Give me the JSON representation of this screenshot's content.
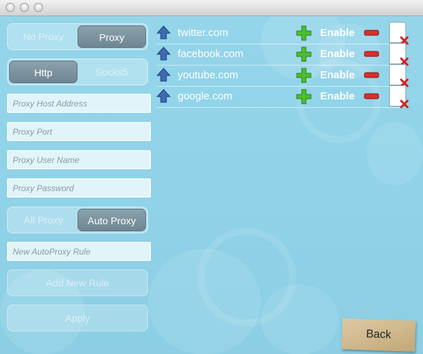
{
  "proxy_mode": {
    "options": [
      "No Proxy",
      "Proxy"
    ],
    "selected": "Proxy"
  },
  "protocol": {
    "options": [
      "Http",
      "Socks5"
    ],
    "selected": "Http"
  },
  "fields": {
    "host_placeholder": "Proxy Host Address",
    "port_placeholder": "Proxy Port",
    "user_placeholder": "Proxy User Name",
    "password_placeholder": "Proxy Password",
    "autoproxy_rule_placeholder": "New AutoProxy Rule"
  },
  "scope": {
    "options": [
      "All Proxy",
      "Auto Proxy"
    ],
    "selected": "Auto Proxy"
  },
  "buttons": {
    "add_rule": "Add New Rule",
    "apply": "Apply",
    "back": "Back"
  },
  "rules": [
    {
      "domain": "twitter.com",
      "enable_label": "Enable"
    },
    {
      "domain": "facebook.com",
      "enable_label": "Enable"
    },
    {
      "domain": "youtube.com",
      "enable_label": "Enable"
    },
    {
      "domain": "google.com",
      "enable_label": "Enable"
    }
  ],
  "colors": {
    "background": "#8fd2e7",
    "segment_active": "#7a909c",
    "plus": "#3fae2a",
    "minus": "#d22a2a",
    "arrow": "#3f6bb5"
  }
}
